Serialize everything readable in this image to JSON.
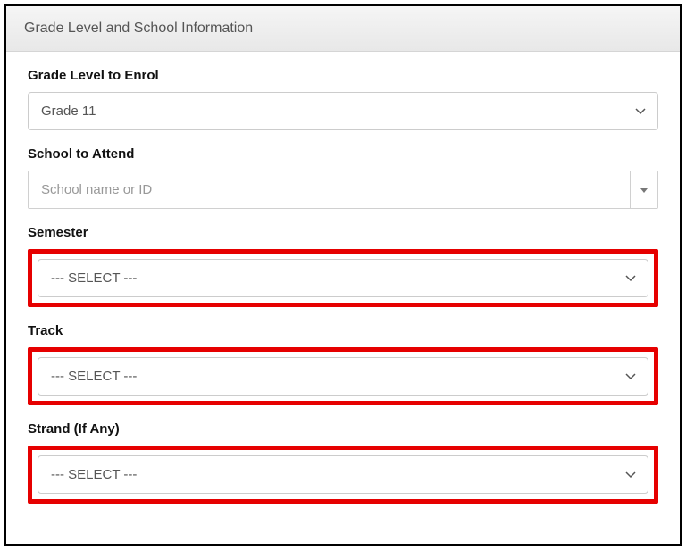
{
  "panel": {
    "title": "Grade Level and School Information"
  },
  "fields": {
    "gradeLevel": {
      "label": "Grade Level to Enrol",
      "value": "Grade 11"
    },
    "school": {
      "label": "School to Attend",
      "placeholder": "School name or ID"
    },
    "semester": {
      "label": "Semester",
      "value": "--- SELECT ---"
    },
    "track": {
      "label": "Track",
      "value": "--- SELECT ---"
    },
    "strand": {
      "label": "Strand (If Any)",
      "value": "--- SELECT ---"
    }
  }
}
